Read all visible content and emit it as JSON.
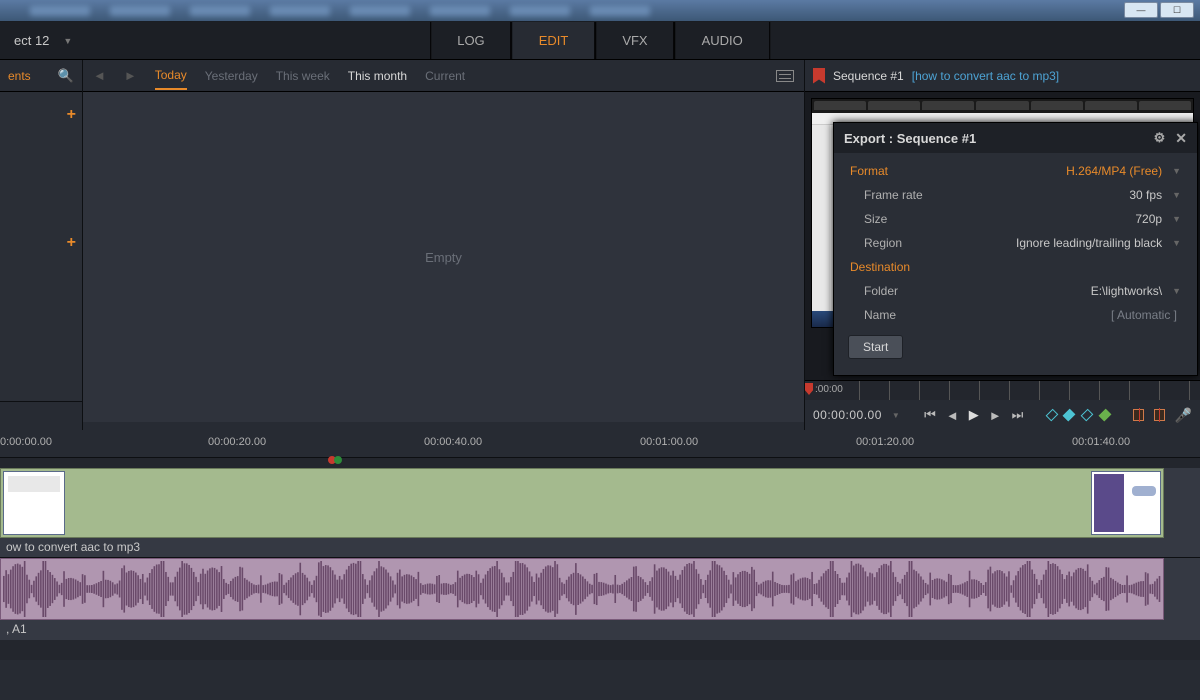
{
  "titlebar": {
    "project": "ect 12"
  },
  "main_tabs": {
    "log": "LOG",
    "edit": "EDIT",
    "vfx": "VFX",
    "audio": "AUDIO"
  },
  "sidebar": {
    "head": "ents"
  },
  "bin": {
    "filters": {
      "today": "Today",
      "yesterday": "Yesterday",
      "thisweek": "This week",
      "thismonth": "This month",
      "current": "Current"
    },
    "empty": "Empty"
  },
  "viewer": {
    "sequence": "Sequence #1",
    "link": "[how to convert aac to mp3]",
    "ruler": ":00:00",
    "timecode": "00:00:00.00"
  },
  "export": {
    "title": "Export : Sequence #1",
    "format_label": "Format",
    "format_value": "H.264/MP4 (Free)",
    "framerate_label": "Frame rate",
    "framerate_value": "30 fps",
    "size_label": "Size",
    "size_value": "720p",
    "region_label": "Region",
    "region_value": "Ignore leading/trailing black",
    "destination": "Destination",
    "folder_label": "Folder",
    "folder_value": "E:\\lightworks\\",
    "name_label": "Name",
    "name_value": "[ Automatic ]",
    "start": "Start"
  },
  "timeline": {
    "ticks": [
      "0:00:00.00",
      "00:00:20.00",
      "00:00:40.00",
      "00:01:00.00",
      "00:01:20.00",
      "00:01:40.00"
    ],
    "video_clip": "ow to convert aac to mp3",
    "audio_clip": ", A1"
  }
}
